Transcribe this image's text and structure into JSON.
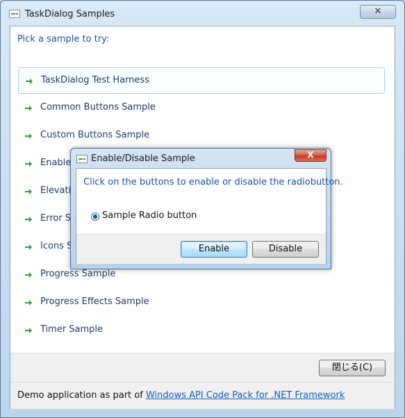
{
  "main_window": {
    "title": "TaskDialog Samples",
    "close_glyph": "✕",
    "instruction": "Pick a sample to try:",
    "commands": [
      {
        "label": "TaskDialog Test Harness"
      },
      {
        "label": "Common Buttons Sample"
      },
      {
        "label": "Custom Buttons Sample"
      },
      {
        "label": "Enable"
      },
      {
        "label": "Elevati"
      },
      {
        "label": "Error S"
      },
      {
        "label": "Icons S"
      },
      {
        "label": "Progress Sample"
      },
      {
        "label": "Progress Effects Sample"
      },
      {
        "label": "Timer Sample"
      }
    ],
    "close_button_label": "閉じる(C)",
    "footer_text": "Demo application as part of ",
    "footer_link": "Windows API Code Pack for .NET Framework"
  },
  "dialog": {
    "title": "Enable/Disable Sample",
    "close_glyph": "X",
    "content": "Click on the buttons to enable or disable the radiobutton.",
    "radio_label": "Sample Radio button",
    "radio_checked": true,
    "enable_label": "Enable",
    "disable_label": "Disable"
  },
  "icons": {
    "window_icon": "taskdialog-app-icon",
    "command_icon": "green-arrow-icon"
  },
  "colors": {
    "instruction_text": "#1a51a8",
    "command_text": "#1c3a6b",
    "arrow_green": "#2ea12e",
    "link": "#0b5fbf",
    "hover_border": "#8fd9e6"
  }
}
